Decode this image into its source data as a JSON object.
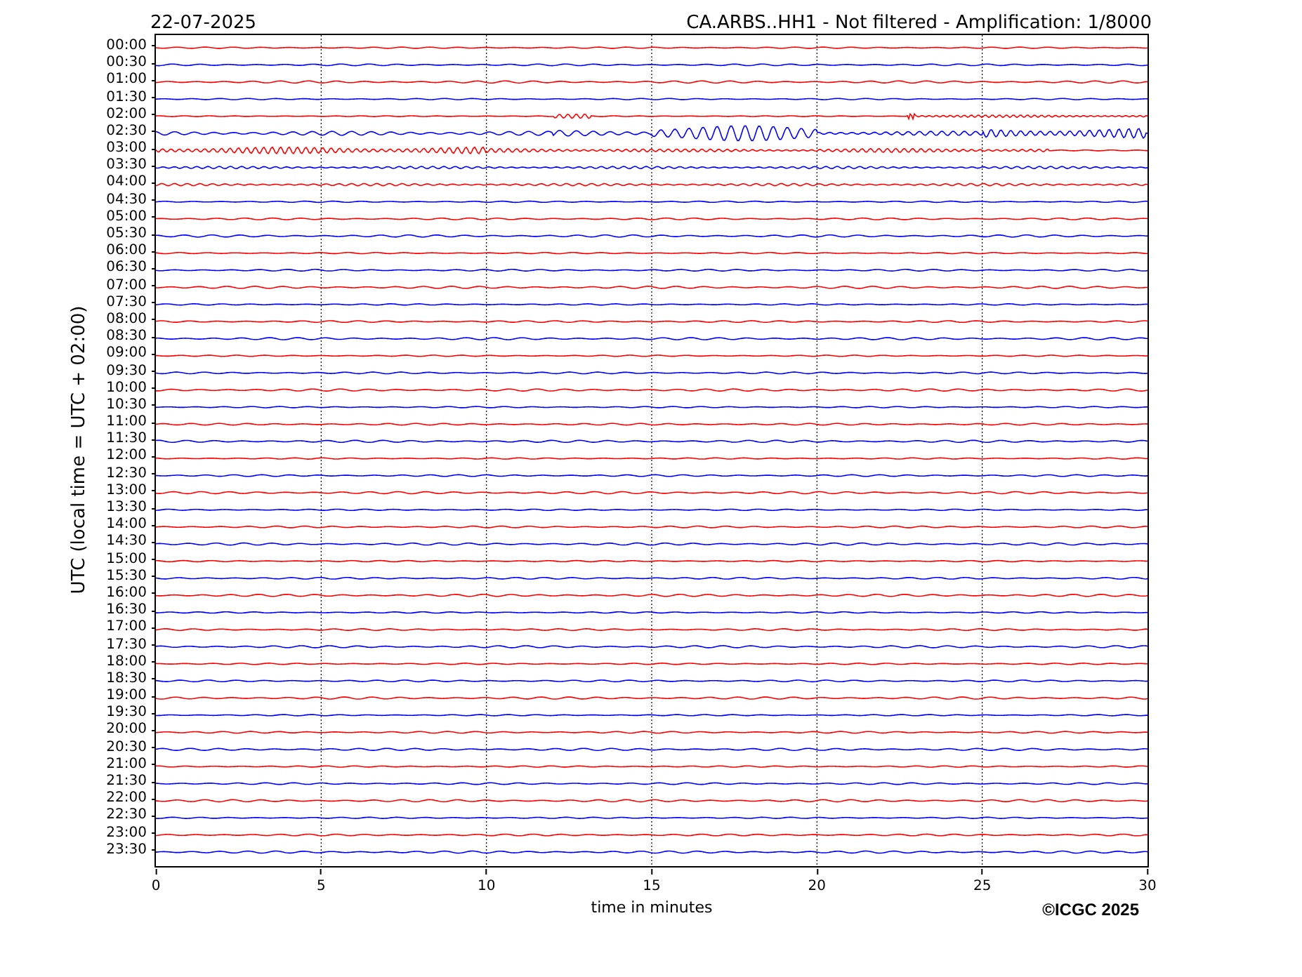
{
  "header": {
    "date": "22-07-2025",
    "title": "CA.ARBS..HH1 - Not filtered - Amplification: 1/8000"
  },
  "chart": {
    "ylabel": "UTC (local time = UTC + 02:00)",
    "xlabel": "time in minutes",
    "xticks": [
      "0",
      "5",
      "10",
      "15",
      "20",
      "25",
      "30"
    ],
    "rows": [
      {
        "label": "00:00",
        "color": "#ff0000"
      },
      {
        "label": "00:30",
        "color": "#0000ff"
      },
      {
        "label": "01:00",
        "color": "#ff0000"
      },
      {
        "label": "01:30",
        "color": "#0000ff"
      },
      {
        "label": "02:00",
        "color": "#ff0000"
      },
      {
        "label": "02:30",
        "color": "#0000ff"
      },
      {
        "label": "03:00",
        "color": "#ff0000"
      },
      {
        "label": "03:30",
        "color": "#0000ff"
      },
      {
        "label": "04:00",
        "color": "#ff0000"
      },
      {
        "label": "04:30",
        "color": "#0000ff"
      },
      {
        "label": "05:00",
        "color": "#ff0000"
      },
      {
        "label": "05:30",
        "color": "#0000ff"
      },
      {
        "label": "06:00",
        "color": "#ff0000"
      },
      {
        "label": "06:30",
        "color": "#0000ff"
      },
      {
        "label": "07:00",
        "color": "#ff0000"
      },
      {
        "label": "07:30",
        "color": "#0000ff"
      },
      {
        "label": "08:00",
        "color": "#ff0000"
      },
      {
        "label": "08:30",
        "color": "#0000ff"
      },
      {
        "label": "09:00",
        "color": "#ff0000"
      },
      {
        "label": "09:30",
        "color": "#0000ff"
      },
      {
        "label": "10:00",
        "color": "#ff0000"
      },
      {
        "label": "10:30",
        "color": "#0000ff"
      },
      {
        "label": "11:00",
        "color": "#ff0000"
      },
      {
        "label": "11:30",
        "color": "#0000ff"
      },
      {
        "label": "12:00",
        "color": "#ff0000"
      },
      {
        "label": "12:30",
        "color": "#0000ff"
      },
      {
        "label": "13:00",
        "color": "#ff0000"
      },
      {
        "label": "13:30",
        "color": "#0000ff"
      },
      {
        "label": "14:00",
        "color": "#ff0000"
      },
      {
        "label": "14:30",
        "color": "#0000ff"
      },
      {
        "label": "15:00",
        "color": "#ff0000"
      },
      {
        "label": "15:30",
        "color": "#0000ff"
      },
      {
        "label": "16:00",
        "color": "#ff0000"
      },
      {
        "label": "16:30",
        "color": "#0000ff"
      },
      {
        "label": "17:00",
        "color": "#ff0000"
      },
      {
        "label": "17:30",
        "color": "#0000ff"
      },
      {
        "label": "18:00",
        "color": "#ff0000"
      },
      {
        "label": "18:30",
        "color": "#0000ff"
      },
      {
        "label": "19:00",
        "color": "#ff0000"
      },
      {
        "label": "19:30",
        "color": "#0000ff"
      },
      {
        "label": "20:00",
        "color": "#ff0000"
      },
      {
        "label": "20:30",
        "color": "#0000ff"
      },
      {
        "label": "21:00",
        "color": "#ff0000"
      },
      {
        "label": "21:30",
        "color": "#0000ff"
      },
      {
        "label": "22:00",
        "color": "#ff0000"
      },
      {
        "label": "22:30",
        "color": "#0000ff"
      },
      {
        "label": "23:00",
        "color": "#ff0000"
      },
      {
        "label": "23:30",
        "color": "#0000ff"
      }
    ]
  },
  "copyright": "©ICGC 2025"
}
